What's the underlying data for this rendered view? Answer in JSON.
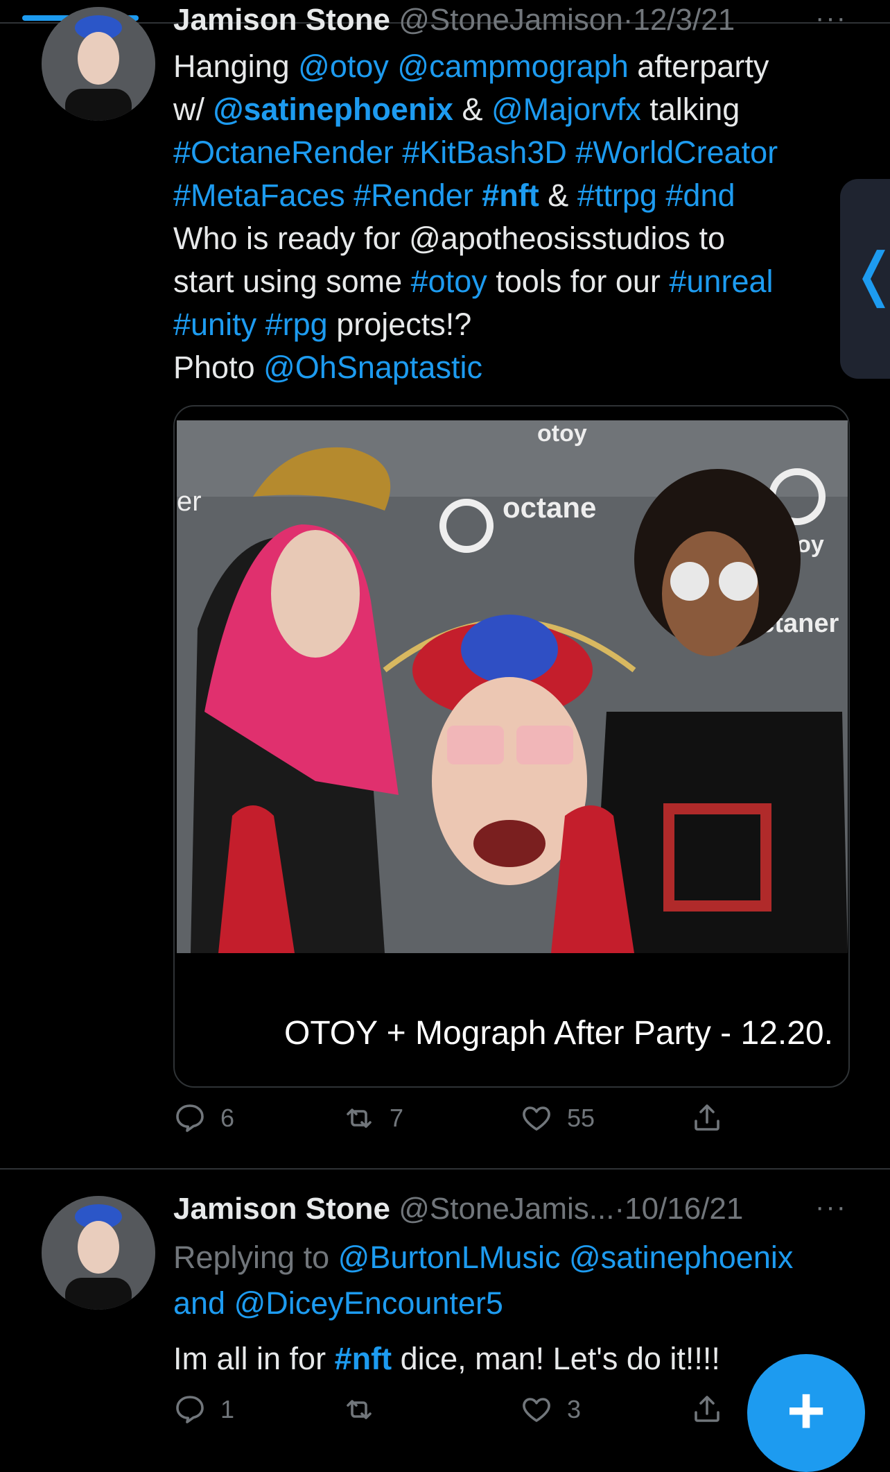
{
  "tweet1": {
    "name": "Jamison Stone",
    "handle": "@StoneJamison",
    "dot": "·",
    "date": "12/3/21",
    "more": "···",
    "line1": {
      "a": "Hanging ",
      "b": "@otoy",
      "c": " ",
      "d": "@campmograph",
      "e": " afterparty"
    },
    "line2": {
      "a": "w/ ",
      "b": "@satinephoenix",
      "c": " & ",
      "d": "@Majorvfx",
      "e": " talking"
    },
    "line3": {
      "a": "#OctaneRender",
      "b": " ",
      "c": "#KitBash3D",
      "d": " ",
      "e": "#WorldCreator"
    },
    "line4": {
      "a": "#MetaFaces",
      "b": " ",
      "c": "#Render",
      "d": " ",
      "e": "#nft",
      "f": " & ",
      "g": "#ttrpg",
      "h": " ",
      "i": "#dnd"
    },
    "line5": "Who is ready for @apotheosisstudios to",
    "line6": {
      "a": "start using some ",
      "b": "#otoy",
      "c": " tools for our ",
      "d": "#unreal"
    },
    "line7": {
      "a": "#unity",
      "b": " ",
      "c": "#rpg",
      "d": " projects!?"
    },
    "line8": {
      "a": "Photo ",
      "b": "@OhSnaptastic"
    },
    "card_caption": "OTOY + Mograph After Party - 12.20.",
    "counts": {
      "replies": "6",
      "retweets": "7",
      "likes": "55"
    }
  },
  "tweet2": {
    "name": "Jamison Stone",
    "handle": "@StoneJamis...",
    "dot": "·",
    "date": "10/16/21",
    "more": "···",
    "replying": {
      "a": "Replying to ",
      "b": "@BurtonLMusic",
      "c": " ",
      "d": "@satinephoenix"
    },
    "replying2": {
      "a": "and ",
      "b": "@DiceyEncounter5"
    },
    "text": {
      "a": "Im all in for ",
      "b": "#nft",
      "c": " dice, man! Let's do it!!!!"
    },
    "counts": {
      "replies": "1",
      "retweets": "",
      "likes": "3"
    }
  },
  "photo_signs": {
    "otoy_top": "otoy",
    "octane": "octane",
    "otoy_right": "otoy",
    "octane_right": "octaner",
    "er_left": "er"
  },
  "side_tab_glyph": "❬",
  "fab_glyph": "+",
  "colors": {
    "accent": "#1d9bf0",
    "background": "#000000",
    "muted": "#71767b",
    "text": "#e7e9ea"
  }
}
